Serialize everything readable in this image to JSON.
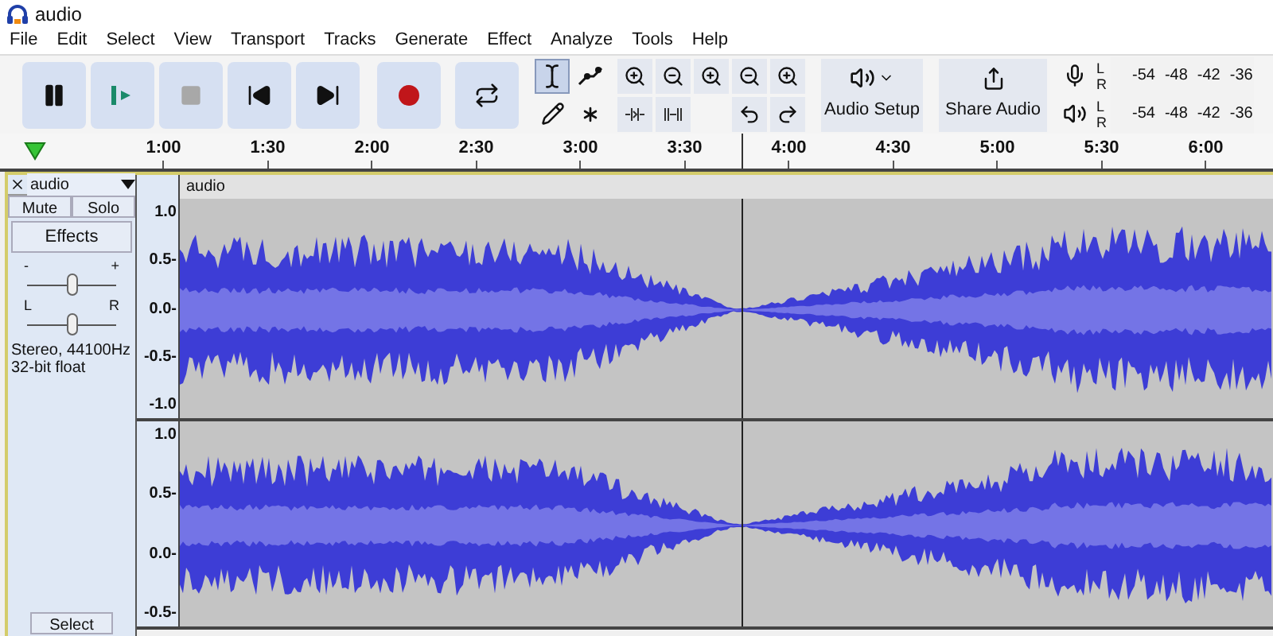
{
  "window": {
    "title": "audio"
  },
  "menu": [
    "File",
    "Edit",
    "Select",
    "View",
    "Transport",
    "Tracks",
    "Generate",
    "Effect",
    "Analyze",
    "Tools",
    "Help"
  ],
  "transport": [
    {
      "kind": "pause"
    },
    {
      "kind": "play"
    },
    {
      "kind": "stop"
    },
    {
      "kind": "skip-start"
    },
    {
      "kind": "skip-end"
    },
    {
      "kind": "record"
    },
    {
      "kind": "loop"
    }
  ],
  "tools": [
    {
      "kind": "select",
      "selected": true
    },
    {
      "kind": "envelope",
      "selected": false
    },
    {
      "kind": "draw",
      "selected": false
    },
    {
      "kind": "multi",
      "selected": false
    }
  ],
  "audio_setup": {
    "label": "Audio Setup"
  },
  "share_audio": {
    "label": "Share Audio"
  },
  "meters": [
    {
      "kind": "record",
      "left": "L",
      "right": "R",
      "ticks": [
        "-54",
        "-48",
        "-42",
        "-36"
      ]
    },
    {
      "kind": "playback",
      "left": "L",
      "right": "R",
      "ticks": [
        "-54",
        "-48",
        "-42",
        "-36"
      ]
    }
  ],
  "timeline": {
    "ticks": [
      "1:00",
      "1:30",
      "2:00",
      "2:30",
      "3:00",
      "3:30",
      "4:00",
      "4:30",
      "5:00",
      "5:30",
      "6:00"
    ]
  },
  "track": {
    "name": "audio",
    "mute": "Mute",
    "solo": "Solo",
    "effects": "Effects",
    "gain": {
      "minus": "-",
      "plus": "+",
      "level": 0.5
    },
    "pan": {
      "left": "L",
      "right": "R",
      "level": 0.5
    },
    "info": "Stereo, 44100Hz\n32-bit float",
    "select": "Select",
    "clip_title": "audio",
    "channels": [
      {
        "scale": [
          "1.0",
          "0.5-",
          "0.0-",
          "-0.5-",
          "-1.0"
        ]
      },
      {
        "scale": [
          "1.0",
          "0.5-",
          "0.0-",
          "-0.5-"
        ]
      }
    ]
  }
}
